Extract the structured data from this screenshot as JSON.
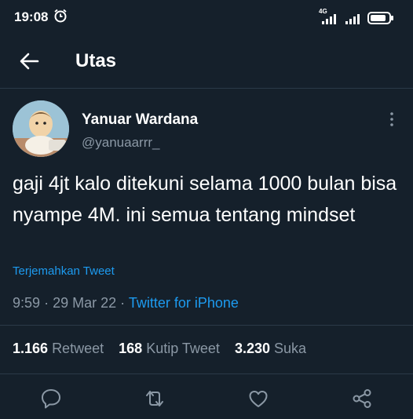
{
  "status_bar": {
    "time": "19:08",
    "network_label": "4G",
    "icons": [
      "alarm-icon",
      "signal-icon",
      "signal-icon",
      "battery-icon"
    ]
  },
  "header": {
    "title": "Utas",
    "back_icon": "arrow-left-icon"
  },
  "tweet": {
    "display_name": "Yanuar Wardana",
    "username": "@yanuaarrr_",
    "text": "gaji 4jt kalo ditekuni selama 1000 bulan bisa nyampe 4M. ini semua tentang mindset",
    "translate_label": "Terjemahkan Tweet",
    "time": "9:59",
    "separator": "·",
    "date": "29 Mar 22",
    "source": "Twitter for iPhone"
  },
  "stats": [
    {
      "count": "1.166",
      "label": "Retweet"
    },
    {
      "count": "168",
      "label": "Kutip Tweet"
    },
    {
      "count": "3.230",
      "label": "Suka"
    }
  ],
  "actions": [
    "reply-icon",
    "retweet-icon",
    "like-icon",
    "share-icon"
  ],
  "colors": {
    "background": "#15202b",
    "accent": "#1d9bf0",
    "secondary_text": "#8b98a5",
    "divider": "#2b3a48"
  }
}
